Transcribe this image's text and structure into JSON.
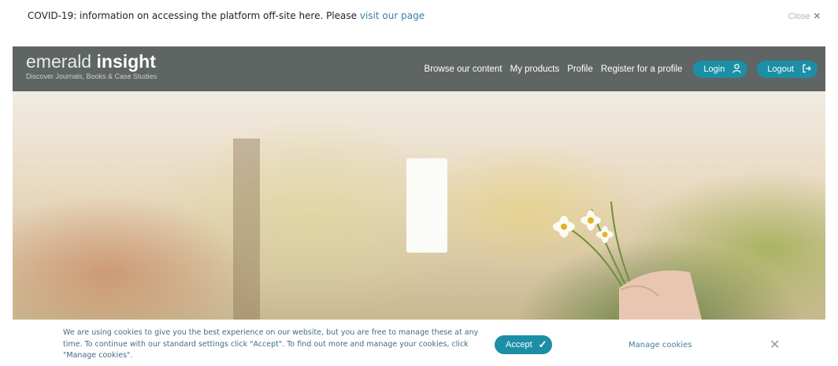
{
  "covid_banner": {
    "text": "COVID-19: information on accessing the platform off-site here. Please",
    "link_text": "visit our page",
    "close_label": "Close",
    "close_icon": "close-icon"
  },
  "header": {
    "logo_light": "emerald",
    "logo_bold": "insight",
    "tagline": "Discover Journals, Books & Case Studies",
    "nav": [
      "Browse our content",
      "My products",
      "Profile",
      "Register for a profile"
    ],
    "login_label": "Login",
    "login_icon": "user-icon",
    "logout_label": "Logout",
    "logout_icon": "logout-icon"
  },
  "cookie_bar": {
    "text": "We are using cookies to give you the best experience on our website, but you are free to manage these at any time. To continue with our standard settings click \"Accept\". To find out more and manage your cookies, click \"Manage cookies\".",
    "accept_label": "Accept",
    "accept_icon": "check-icon",
    "manage_label": "Manage cookies",
    "close_icon": "close-icon"
  },
  "colors": {
    "header_bg": "#5e6563",
    "accent": "#1c8fa6",
    "link": "#3a7fa3"
  }
}
